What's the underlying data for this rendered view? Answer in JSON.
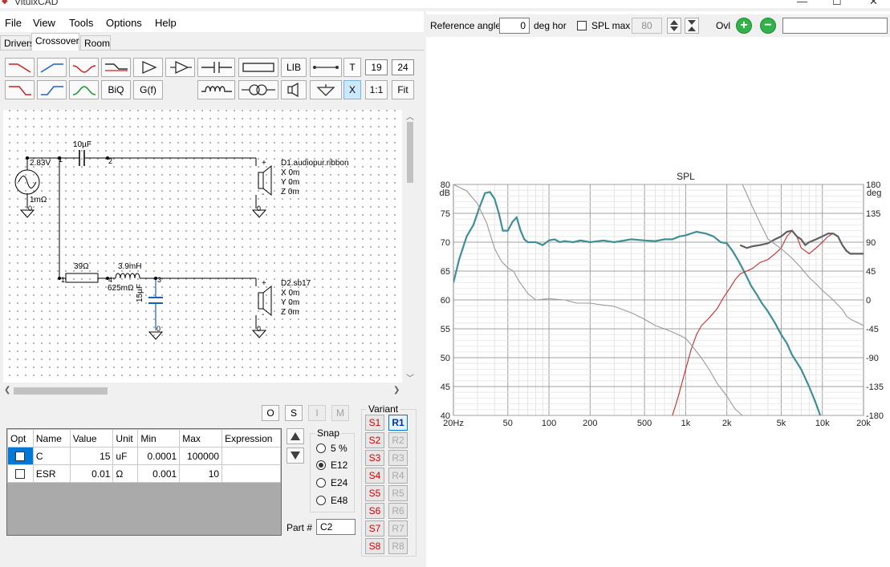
{
  "window": {
    "title": "VituixCAD",
    "controls": [
      "—",
      "☐",
      "✕"
    ]
  },
  "menu": [
    "File",
    "View",
    "Tools",
    "Options",
    "Help"
  ],
  "tabs": [
    "Drivers",
    "Crossover",
    "Room"
  ],
  "active_tab": "Crossover",
  "toolbar": {
    "lib_label": "LIB",
    "t_label": "T",
    "x_label": "X",
    "biq_label": "BiQ",
    "gf_label": "G(f)",
    "one_to_one_label": "1:1",
    "fit_label": "Fit",
    "grid_size_a": "19",
    "grid_size_b": "24"
  },
  "schematic": {
    "source_voltage": "2.83V",
    "source_resistance": "1mΩ",
    "cap1": "10µF",
    "res1": "39Ω",
    "ind1": "3.9mH",
    "ind1_esr": "625mΩ",
    "cap2": "15µF",
    "node_1": "1",
    "node_2": "2",
    "node_3": "3",
    "node_4": "4",
    "gnd": "0",
    "plus": "+",
    "minus": "-",
    "driver1": {
      "name": "D1.audiopur.ribbon",
      "x": "X 0m",
      "y": "Y 0m",
      "z": "Z 0m"
    },
    "driver2": {
      "name": "D2.sb17",
      "x": "X 0m",
      "y": "Y 0m",
      "z": "Z 0m"
    }
  },
  "osim": [
    "O",
    "S",
    "I",
    "M"
  ],
  "grid_table": {
    "columns": [
      "Opt",
      "Name",
      "Value",
      "Unit",
      "Min",
      "Max",
      "Expression"
    ],
    "rows": [
      {
        "name": "C",
        "value": "15",
        "unit": "uF",
        "min": "0.0001",
        "max": "100000",
        "expression": ""
      },
      {
        "name": "ESR",
        "value": "0.01",
        "unit": "Ω",
        "min": "0.001",
        "max": "10",
        "expression": ""
      }
    ]
  },
  "snap": {
    "title": "Snap",
    "options": [
      "5 %",
      "E12",
      "E24",
      "E48"
    ],
    "selected": "E12"
  },
  "part": {
    "label": "Part #",
    "value": "C2"
  },
  "variant": {
    "title": "Variant",
    "s": [
      "S1",
      "S2",
      "S3",
      "S4",
      "S5",
      "S6",
      "S7",
      "S8"
    ],
    "r": [
      "R1",
      "R2",
      "R3",
      "R4",
      "R5",
      "R6",
      "R7",
      "R8"
    ],
    "active_r": "R1"
  },
  "right_toolbar": {
    "ref_angle_label": "Reference angle",
    "ref_angle_value": "0",
    "deg_hor": "deg hor",
    "spl_max_label": "SPL max",
    "spl_max_value": "80",
    "ovl_label": "Ovl"
  },
  "chart_data": {
    "type": "line",
    "title": "SPL",
    "xlabel": "Hz",
    "ylabel": "dB",
    "y2label": "deg",
    "x_scale": "log",
    "xlim": [
      20,
      20000
    ],
    "ylim": [
      40,
      80
    ],
    "y2lim": [
      -180,
      180
    ],
    "x_ticks": [
      "20Hz",
      "50",
      "100",
      "200",
      "500",
      "1k",
      "2k",
      "5k",
      "10k",
      "20k"
    ],
    "y_ticks": [
      "80",
      "75",
      "70",
      "65",
      "60",
      "55",
      "50",
      "45",
      "40"
    ],
    "y2_ticks": [
      "180",
      "135",
      "90",
      "45",
      "0",
      "-45",
      "-90",
      "-135",
      "-180"
    ],
    "grid": true,
    "series": [
      {
        "color": "#3f8f97",
        "axis": "left",
        "x": [
          20,
          22,
          25,
          28,
          31,
          34,
          37,
          40,
          43,
          46,
          50,
          54,
          58,
          62,
          66,
          70,
          80,
          90,
          100,
          110,
          120,
          130,
          150,
          170,
          200,
          250,
          300,
          400,
          500,
          600,
          700,
          800,
          900,
          1000,
          1200,
          1400,
          1600,
          1800,
          2000,
          2200,
          2400,
          2600,
          2800,
          3000,
          3300,
          3600,
          4000,
          4500,
          5000,
          5500,
          6000,
          7000,
          8000,
          9000,
          10000
        ],
        "y": [
          63,
          67,
          71,
          73,
          76,
          78.5,
          78.7,
          77.5,
          75,
          72,
          72,
          73.5,
          74.3,
          72,
          70.5,
          70,
          70,
          69.5,
          70.3,
          70.5,
          70,
          70.2,
          70,
          70.3,
          70,
          70.3,
          70,
          70.5,
          70.3,
          70.2,
          70.5,
          70.5,
          71,
          71.2,
          71.8,
          71.5,
          71,
          70,
          69.8,
          68.5,
          67,
          65.5,
          64,
          62.5,
          61,
          59.5,
          58,
          56,
          54,
          52.5,
          50.5,
          48,
          45,
          42,
          39
        ]
      },
      {
        "color": "#cc2a2a",
        "axis": "left",
        "x": [
          800,
          850,
          900,
          1000,
          1100,
          1200,
          1300,
          1500,
          1700,
          1900,
          2100,
          2300,
          2500,
          2800,
          3100,
          3500,
          4000,
          4500,
          5000,
          5500,
          6000,
          6500,
          7000,
          7500,
          8000,
          9000,
          10000,
          11000,
          12000,
          13000
        ],
        "y": [
          40,
          42,
          44,
          48,
          51.5,
          54,
          55.5,
          57,
          58.5,
          60.5,
          62,
          63.5,
          64.5,
          65,
          65.5,
          66.5,
          67,
          68,
          69,
          71,
          72,
          71,
          69,
          68.5,
          68,
          69,
          70,
          71,
          71.5,
          71
        ]
      },
      {
        "color": "#5f5f5f",
        "axis": "left",
        "x": [
          2500,
          2800,
          3100,
          3500,
          4000,
          4500,
          5000,
          5500,
          6000,
          6500,
          7000,
          7500,
          8000,
          9000,
          10000,
          11000,
          12000,
          13000,
          14000,
          15000,
          16000,
          18000,
          20000
        ],
        "y": [
          69.5,
          69,
          69.3,
          69.5,
          69.8,
          70.5,
          71,
          71.8,
          72,
          71,
          70.5,
          69.5,
          70,
          70.5,
          71,
          71.5,
          71.5,
          71,
          69.5,
          68.5,
          68,
          68,
          68
        ]
      },
      {
        "color": "#9a9a9a",
        "axis": "right",
        "x": [
          20,
          25,
          30,
          35,
          40,
          45,
          50,
          55,
          60,
          70,
          80,
          100,
          130,
          160,
          200,
          250,
          300,
          400,
          500,
          600,
          700,
          800,
          900,
          1000,
          1100
        ],
        "y": [
          180,
          170,
          150,
          120,
          80,
          60,
          50,
          45,
          30,
          10,
          0,
          2,
          0,
          -5,
          -5,
          -8,
          -10,
          -20,
          -30,
          -40,
          -45,
          -50,
          -55,
          -60,
          -70
        ]
      },
      {
        "color": "#9a9a9a",
        "axis": "right",
        "x": [
          1100,
          1300,
          1500,
          1700,
          2000,
          2300,
          2600,
          2600,
          2800,
          3000,
          3500,
          4000,
          5000,
          6000,
          7000,
          8000,
          9000,
          10000,
          12000,
          14000,
          15000,
          16000,
          18000,
          20000
        ],
        "y": [
          -70,
          -90,
          -110,
          -130,
          -150,
          -170,
          -180,
          180,
          165,
          150,
          120,
          95,
          80,
          65,
          50,
          35,
          25,
          15,
          0,
          -15,
          -25,
          -30,
          -35,
          -40
        ]
      }
    ]
  }
}
